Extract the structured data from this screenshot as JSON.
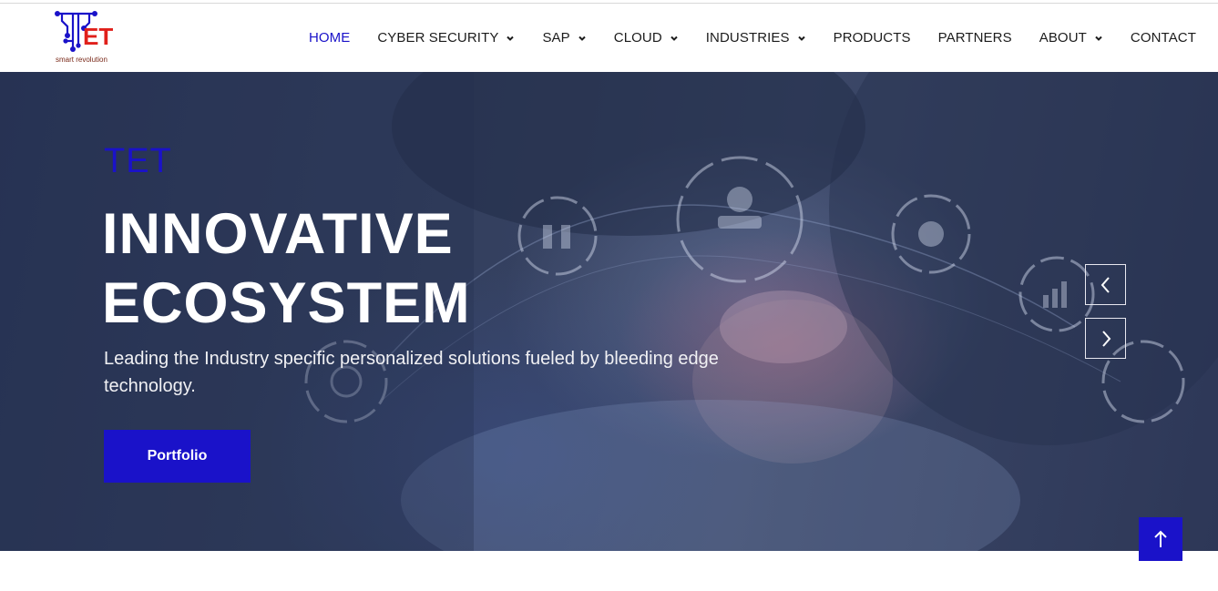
{
  "brand": {
    "logo_letters": "ET",
    "tagline": "smart revolution",
    "primary_color": "#1a12c9",
    "logo_red": "#e0201b"
  },
  "nav": {
    "items": [
      {
        "label": "HOME",
        "active": true,
        "dropdown": false
      },
      {
        "label": "CYBER SECURITY",
        "active": false,
        "dropdown": true
      },
      {
        "label": "SAP",
        "active": false,
        "dropdown": true
      },
      {
        "label": "CLOUD",
        "active": false,
        "dropdown": true
      },
      {
        "label": "INDUSTRIES",
        "active": false,
        "dropdown": true
      },
      {
        "label": "PRODUCTS",
        "active": false,
        "dropdown": false
      },
      {
        "label": "PARTNERS",
        "active": false,
        "dropdown": false
      },
      {
        "label": "ABOUT",
        "active": false,
        "dropdown": true
      },
      {
        "label": "CONTACT",
        "active": false,
        "dropdown": false
      }
    ]
  },
  "hero": {
    "tag": "TET",
    "headline_line1": "INNOVATIVE",
    "headline_line2": "ECOSYSTEM",
    "subtitle": "Leading the Industry specific personalized solutions fueled by bleeding edge technology.",
    "cta_label": "Portfolio",
    "prev_icon": "chevron-left-icon",
    "next_icon": "chevron-right-icon"
  },
  "scroll_top": {
    "icon": "arrow-up-icon"
  }
}
